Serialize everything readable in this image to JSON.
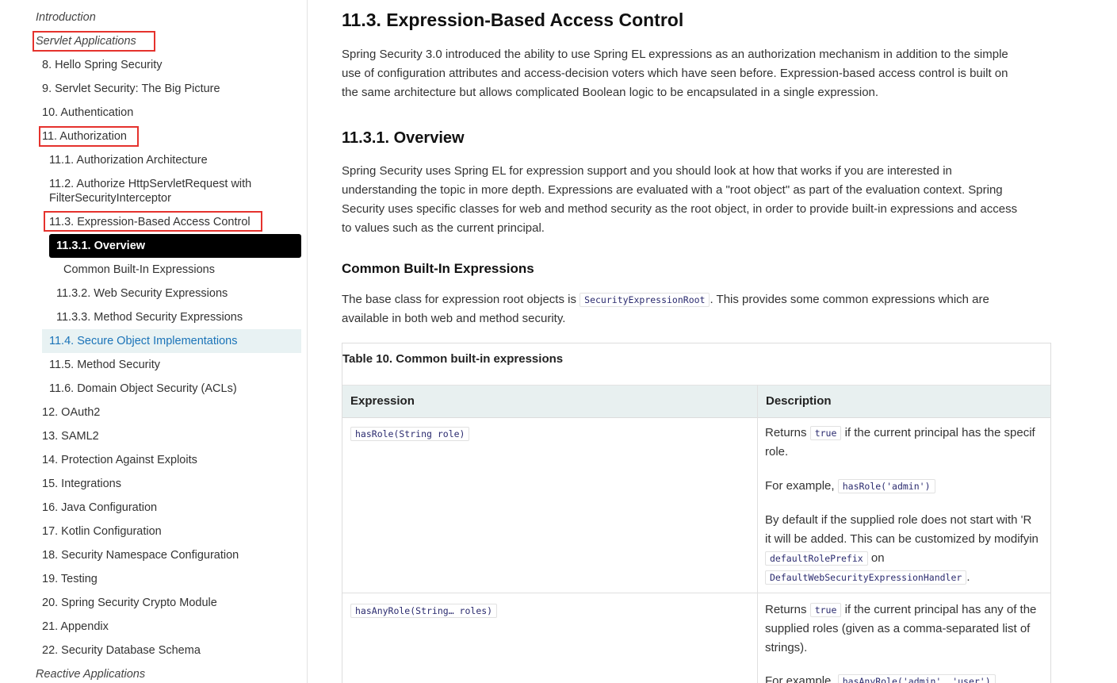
{
  "sidebar": {
    "items": [
      {
        "label": "Introduction"
      },
      {
        "label": "Servlet Applications"
      },
      {
        "label": "8. Hello Spring Security"
      },
      {
        "label": "9. Servlet Security: The Big Picture"
      },
      {
        "label": "10. Authentication"
      },
      {
        "label": "11. Authorization"
      },
      {
        "label": "11.1. Authorization Architecture"
      },
      {
        "label": "11.2. Authorize HttpServletRequest with FilterSecurityInterceptor"
      },
      {
        "label": "11.3. Expression-Based Access Control"
      },
      {
        "label": "11.3.1. Overview"
      },
      {
        "label": "Common Built-In Expressions"
      },
      {
        "label": "11.3.2. Web Security Expressions"
      },
      {
        "label": "11.3.3. Method Security Expressions"
      },
      {
        "label": "11.4. Secure Object Implementations"
      },
      {
        "label": "11.5. Method Security"
      },
      {
        "label": "11.6. Domain Object Security (ACLs)"
      },
      {
        "label": "12. OAuth2"
      },
      {
        "label": "13. SAML2"
      },
      {
        "label": "14. Protection Against Exploits"
      },
      {
        "label": "15. Integrations"
      },
      {
        "label": "16. Java Configuration"
      },
      {
        "label": "17. Kotlin Configuration"
      },
      {
        "label": "18. Security Namespace Configuration"
      },
      {
        "label": "19. Testing"
      },
      {
        "label": "20. Spring Security Crypto Module"
      },
      {
        "label": "21. Appendix"
      },
      {
        "label": "22. Security Database Schema"
      },
      {
        "label": "Reactive Applications"
      }
    ]
  },
  "main": {
    "title": "11.3. Expression-Based Access Control",
    "intro_line1": "Spring Security 3.0 introduced the ability to use Spring EL expressions as an authorization mechanism in addition to the simple",
    "intro_line2": "use of configuration attributes and access-decision voters which have seen before. Expression-based access control is built on",
    "intro_line3": "the same architecture but allows complicated Boolean logic to be encapsulated in a single expression.",
    "overview_heading": "11.3.1. Overview",
    "overview_line1": "Spring Security uses Spring EL for expression support and you should look at how that works if you are interested in",
    "overview_line2": "understanding the topic in more depth. Expressions are evaluated with a \"root object\" as part of the evaluation context. Spring",
    "overview_line3": "Security uses specific classes for web and method security as the root object, in order to provide built-in expressions and access",
    "overview_line4": "to values such as the current principal.",
    "builtin_heading": "Common Built-In Expressions",
    "builtin_text_a": "The base class for expression root objects is",
    "builtin_code": "SecurityExpressionRoot",
    "builtin_text_b": ". This provides some common expressions which are",
    "builtin_text_c": "available in both web and method security.",
    "table": {
      "caption": "Table 10. Common built-in expressions",
      "columns": [
        "Expression",
        "Description"
      ],
      "rows": [
        {
          "expression": "hasRole(String role)",
          "returns": "Returns",
          "true_code": "true",
          "line1_rest": "if the current principal has the specif",
          "line2": "role.",
          "example_text": "For example,",
          "example_code": "hasRole('admin')",
          "default_line1": "By default if the supplied role does not start with 'R",
          "default_line2": "it will be added. This can be customized by modifyin",
          "custom_code1": "defaultRolePrefix",
          "on_text": "on",
          "custom_code2": "DefaultWebSecurityExpressionHandler",
          "period": "."
        },
        {
          "expression": "hasAnyRole(String… roles)",
          "returns": "Returns",
          "true_code": "true",
          "line1_rest": "if the current principal has any of the",
          "line2": "supplied roles (given as a comma-separated list of",
          "line3": "strings).",
          "example_text": "For example,",
          "example_code": "hasAnyRole('admin', 'user')"
        }
      ]
    }
  },
  "colors": {
    "highlight_box": "#e5322d",
    "active_bg": "#000000",
    "hover_bg": "#e8f2f3",
    "link": "#1a73b8",
    "table_header_bg": "#e8f0f0"
  }
}
